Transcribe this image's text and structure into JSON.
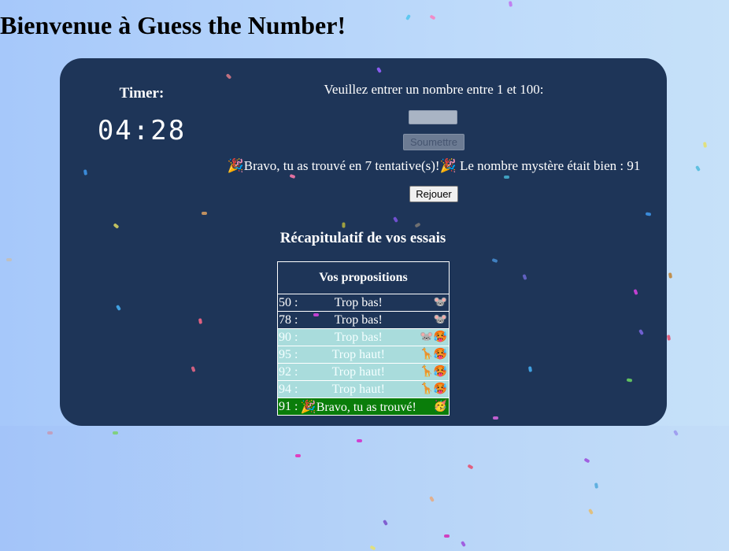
{
  "page": {
    "title": "Bienvenue à Guess the Number!"
  },
  "timer": {
    "label": "Timer:",
    "value": "04:28"
  },
  "game": {
    "prompt": "Veuillez entrer un nombre entre 1 et 100:",
    "input_value": "",
    "submit_label": "Soumettre",
    "result_message": "🎉Bravo, tu as trouvé en 7 tentative(s)!🎉 Le nombre mystère était bien : 91",
    "replay_label": "Rejouer"
  },
  "recap": {
    "title": "Récapitulatif de vos essais",
    "table_header": "Vos propositions",
    "rows": [
      {
        "number": "50 :",
        "message": "Trop bas!",
        "emoji": "🐭",
        "style": "dark"
      },
      {
        "number": "78 :",
        "message": "Trop bas!",
        "emoji": "🐭",
        "style": "dark"
      },
      {
        "number": "90 :",
        "message": "Trop bas!",
        "emoji": "🐭🥵",
        "style": "light"
      },
      {
        "number": "95 :",
        "message": "Trop haut!",
        "emoji": "🦒🥵",
        "style": "light"
      },
      {
        "number": "92 :",
        "message": "Trop haut!",
        "emoji": "🦒🥵",
        "style": "light"
      },
      {
        "number": "94 :",
        "message": "Trop haut!",
        "emoji": "🦒🥵",
        "style": "light"
      },
      {
        "number": "91 :",
        "message": "🎉Bravo, tu as trouvé!",
        "emoji": "🥳",
        "style": "win"
      }
    ]
  },
  "colors": {
    "card_background": "#1e3558",
    "hot_row": "#a9dcdc",
    "win_row": "#0a7d0a",
    "page_background": "#b4d2f8"
  }
}
